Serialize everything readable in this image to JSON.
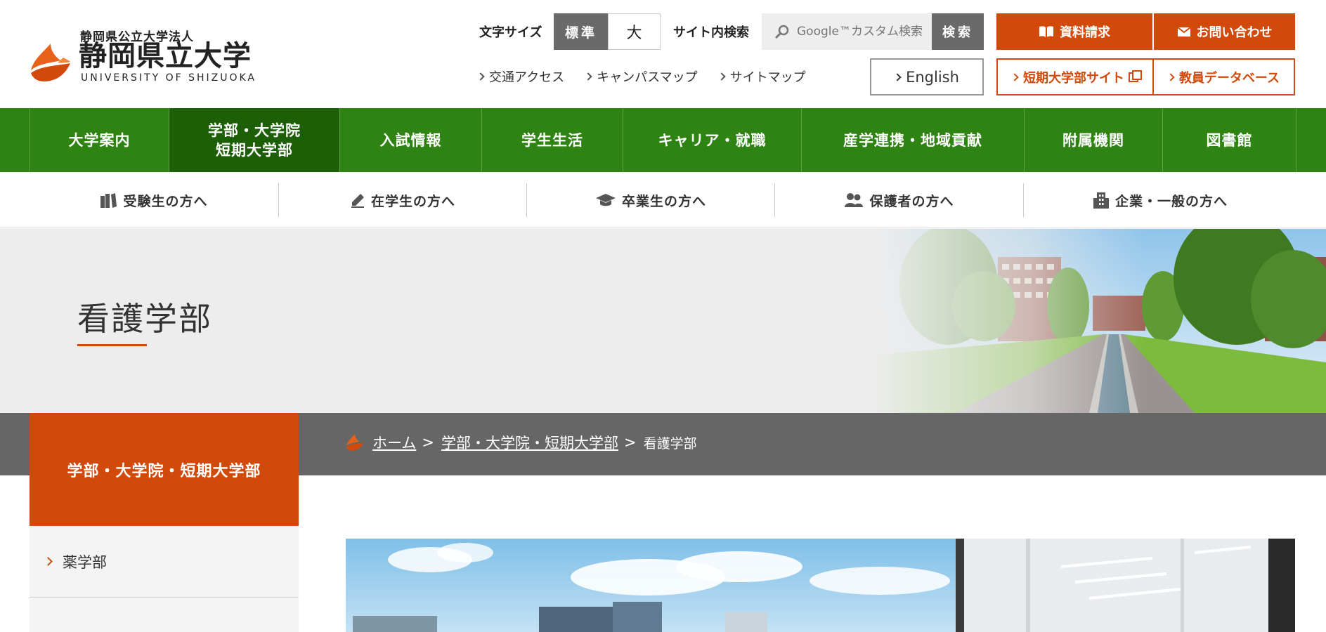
{
  "header": {
    "logo": {
      "sub": "静岡県公立大学法人",
      "main": "静岡県立大学",
      "en": "UNIVERSITY OF SHIZUOKA"
    },
    "font_size": {
      "label": "文字サイズ",
      "standard": "標準",
      "large": "大"
    },
    "search": {
      "label": "サイト内検索",
      "placeholder": "Google™カスタム検索",
      "button": "検索"
    },
    "util_links": [
      "交通アクセス",
      "キャンパスマップ",
      "サイトマップ"
    ],
    "english": "English",
    "request": "資料請求",
    "contact": "お問い合わせ",
    "junior_college": "短期大学部サイト",
    "faculty_db": "教員データベース"
  },
  "gnav": [
    "大学案内",
    "学部・大学院\n短期大学部",
    "入試情報",
    "学生生活",
    "キャリア・就職",
    "産学連携・地域貢献",
    "附属機関",
    "図書館"
  ],
  "audience_nav": [
    {
      "label": "受験生の方へ",
      "icon": "books-icon"
    },
    {
      "label": "在学生の方へ",
      "icon": "pencil-icon"
    },
    {
      "label": "卒業生の方へ",
      "icon": "graduation-cap-icon"
    },
    {
      "label": "保護者の方へ",
      "icon": "people-icon"
    },
    {
      "label": "企業・一般の方へ",
      "icon": "building-icon"
    }
  ],
  "hero": {
    "title": "看護学部"
  },
  "sidebar": {
    "heading": "学部・大学院・短期大学部",
    "items": [
      "薬学部"
    ]
  },
  "breadcrumb": {
    "home": "ホーム",
    "parent": "学部・大学院・短期大学部",
    "current": "看護学部",
    "separator": ">"
  },
  "colors": {
    "brand_orange": "#d14a0c",
    "nav_green": "#2e8312",
    "nav_green_active": "#1d5f07",
    "breadcrumb_gray": "#666666"
  }
}
